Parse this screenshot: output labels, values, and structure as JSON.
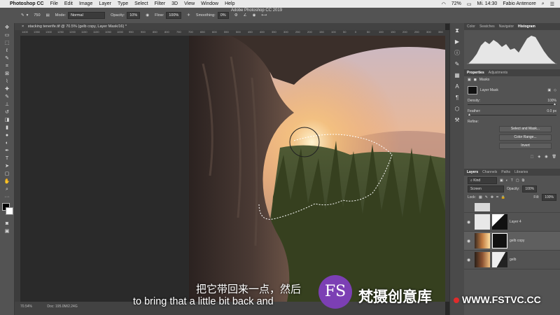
{
  "menubar": {
    "app": "Photoshop CC",
    "items": [
      "File",
      "Edit",
      "Image",
      "Layer",
      "Type",
      "Select",
      "Filter",
      "3D",
      "View",
      "Window",
      "Help"
    ],
    "battery": "72%",
    "clock": "Mi. 14:30",
    "user": "Fabio Antenore"
  },
  "window_title": "Adobe Photoshop CC 2019",
  "options": {
    "mode_label": "Mode:",
    "mode_value": "Normal",
    "opacity_label": "Opacity:",
    "opacity_value": "10%",
    "flow_label": "Flow:",
    "flow_value": "100%",
    "smoothing_label": "Smoothing:",
    "smoothing_value": "0%",
    "brush_size": "750"
  },
  "document": {
    "tab": "stacking tenerife.tif @ 70.5% (gelb copy, Layer Mask/16) *",
    "zoom": "70.54%",
    "doc_info": "Doc: 195.0M/2.24G"
  },
  "ruler_ticks": [
    "1400",
    "1350",
    "1300",
    "1250",
    "1200",
    "1150",
    "1100",
    "1050",
    "1000",
    "950",
    "900",
    "850",
    "800",
    "750",
    "700",
    "650",
    "600",
    "550",
    "500",
    "450",
    "400",
    "350",
    "300",
    "250",
    "200",
    "150",
    "100",
    "50",
    "0",
    "50",
    "100",
    "150",
    "200",
    "250",
    "300",
    "350",
    "400",
    "450",
    "500",
    "550",
    "600",
    "650",
    "700",
    "750",
    "800",
    "850",
    "900",
    "950",
    "1000",
    "1050",
    "1100",
    "1150",
    "1200",
    "1250",
    "1300",
    "1350",
    "1400",
    "1450",
    "1500",
    "1550",
    "1600",
    "1650",
    "1700",
    "1750",
    "1800",
    "1850",
    "1900",
    "1950",
    "2000",
    "2050",
    "2100",
    "2150",
    "2200",
    "2250"
  ],
  "panels": {
    "top_tabs": [
      "Color",
      "Swatches",
      "Navigator",
      "Histogram"
    ],
    "properties_tabs": [
      "Properties",
      "Adjustments"
    ],
    "masks_label": "Masks",
    "layer_mask_label": "Layer Mask",
    "density_label": "Density:",
    "density_value": "100%",
    "feather_label": "Feather:",
    "feather_value": "0.0 px",
    "refine_label": "Refine:",
    "select_mask_btn": "Select and Mask...",
    "color_range_btn": "Color Range...",
    "invert_btn": "Invert",
    "layers_tabs": [
      "Layers",
      "Channels",
      "Paths",
      "Libraries"
    ],
    "kind_label": "Kind",
    "blend_mode": "Screen",
    "opacity_label": "Opacity:",
    "opacity_value": "100%",
    "lock_label": "Lock:",
    "fill_label": "Fill:",
    "fill_value": "100%",
    "layers": [
      "Layer 4",
      "gelb copy",
      "gelb"
    ]
  },
  "subtitles": {
    "zh": "把它带回来一点，然后",
    "en": "to bring that a little bit back and"
  },
  "watermark": {
    "logo": "FS",
    "cn": "梵摄创意库",
    "url": "WWW.FSTVC.CC"
  },
  "colors": {
    "accent": "#7c3fb4",
    "ps_panel": "#535353",
    "menubar": "#e9e9e9"
  }
}
